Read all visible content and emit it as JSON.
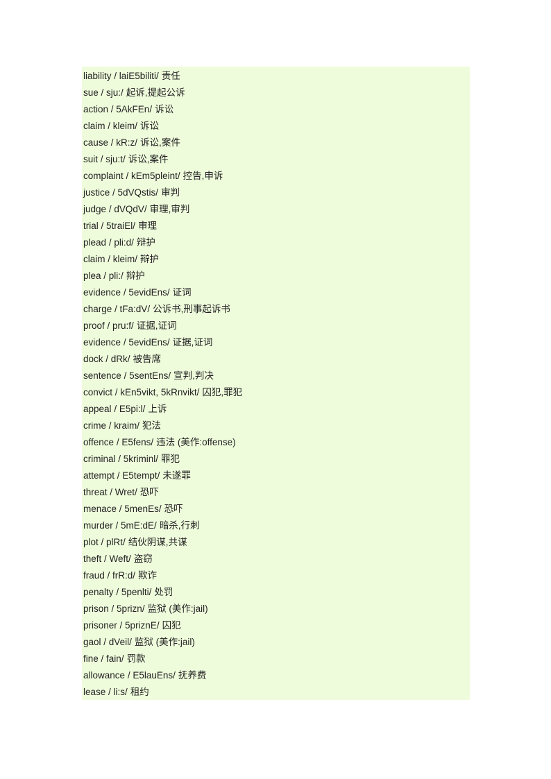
{
  "entries": [
    {
      "word": "liability",
      "phonetic": "/ laiE5biliti/",
      "meaning": "责任"
    },
    {
      "word": "sue",
      "phonetic": "/ sju:/",
      "meaning": "起诉,提起公诉"
    },
    {
      "word": "action",
      "phonetic": "/ 5AkFEn/",
      "meaning": "诉讼"
    },
    {
      "word": "claim ",
      "phonetic": "/ kleim/",
      "meaning": "诉讼"
    },
    {
      "word": "cause",
      "phonetic": "/ kR:z/",
      "meaning": "诉讼,案件"
    },
    {
      "word": "suit",
      "phonetic": "/ sju:t/",
      "meaning": "诉讼,案件"
    },
    {
      "word": "complaint",
      "phonetic": "/ kEm5pleint/",
      "meaning": "控告,申诉"
    },
    {
      "word": "justice",
      "phonetic": "/ 5dVQstis/",
      "meaning": "审判"
    },
    {
      "word": "judge",
      "phonetic": "/ dVQdV/",
      "meaning": "审理,审判"
    },
    {
      "word": "trial",
      "phonetic": "/ 5traiEl/",
      "meaning": "审理"
    },
    {
      "word": "plead",
      "phonetic": "/ pli:d/",
      "meaning": "辩护"
    },
    {
      "word": "claim ",
      "phonetic": "/ kleim/",
      "meaning": "辩护"
    },
    {
      "word": "plea",
      "phonetic": "/ pli:/",
      "meaning": "辩护"
    },
    {
      "word": "evidence",
      "phonetic": "/ 5evidEns/",
      "meaning": "证词"
    },
    {
      "word": "charge",
      "phonetic": "/ tFa:dV/",
      "meaning": "公诉书,刑事起诉书"
    },
    {
      "word": "proof",
      "phonetic": "/ pru:f/",
      "meaning": "证据,证词"
    },
    {
      "word": "evidence",
      "phonetic": "/ 5evidEns/",
      "meaning": "证据,证词"
    },
    {
      "word": "dock",
      "phonetic": "/ dRk/",
      "meaning": "被告席"
    },
    {
      "word": "sentence",
      "phonetic": "/ 5sentEns/",
      "meaning": "宣判,判决"
    },
    {
      "word": "convict",
      "phonetic": "/ kEn5vikt, 5kRnvikt/",
      "meaning": "囚犯,罪犯"
    },
    {
      "word": "appeal",
      "phonetic": "/ E5pi:l/",
      "meaning": "上诉"
    },
    {
      "word": "crime",
      "phonetic": "/ kraim/",
      "meaning": "犯法"
    },
    {
      "word": "offence",
      "phonetic": "/ E5fens/",
      "meaning": "违法  (美作:offense)"
    },
    {
      "word": "criminal",
      "phonetic": "/ 5kriminl/",
      "meaning": "罪犯"
    },
    {
      "word": "attempt",
      "phonetic": "/ E5tempt/",
      "meaning": "未遂罪"
    },
    {
      "word": "threat",
      "phonetic": "/ Wret/",
      "meaning": "恐吓"
    },
    {
      "word": "menace",
      "phonetic": "/ 5menEs/",
      "meaning": "恐吓"
    },
    {
      "word": "murder",
      "phonetic": "/ 5mE:dE/",
      "meaning": "暗杀,行刺"
    },
    {
      "word": "plot",
      "phonetic": "/ plRt/",
      "meaning": "结伙阴谋,共谋"
    },
    {
      "word": "theft",
      "phonetic": "/ Weft/",
      "meaning": "盗窃"
    },
    {
      "word": "fraud",
      "phonetic": "/ frR:d/",
      "meaning": "欺诈"
    },
    {
      "word": "penalty",
      "phonetic": "/ 5penlti/",
      "meaning": "处罚"
    },
    {
      "word": "prison",
      "phonetic": "/ 5prizn/",
      "meaning": "监狱  (美作:jail)"
    },
    {
      "word": "prisoner",
      "phonetic": "/ 5priznE/",
      "meaning": "囚犯"
    },
    {
      "word": "gaol",
      "phonetic": "/ dVeil/",
      "meaning": "监狱  (美作:jail)"
    },
    {
      "word": "fine",
      "phonetic": "/ fain/",
      "meaning": "罚款"
    },
    {
      "word": "allowance",
      "phonetic": "/ E5lauEns/",
      "meaning": "抚养费"
    },
    {
      "word": "lease",
      "phonetic": "/ li:s/",
      "meaning": "租约"
    }
  ]
}
